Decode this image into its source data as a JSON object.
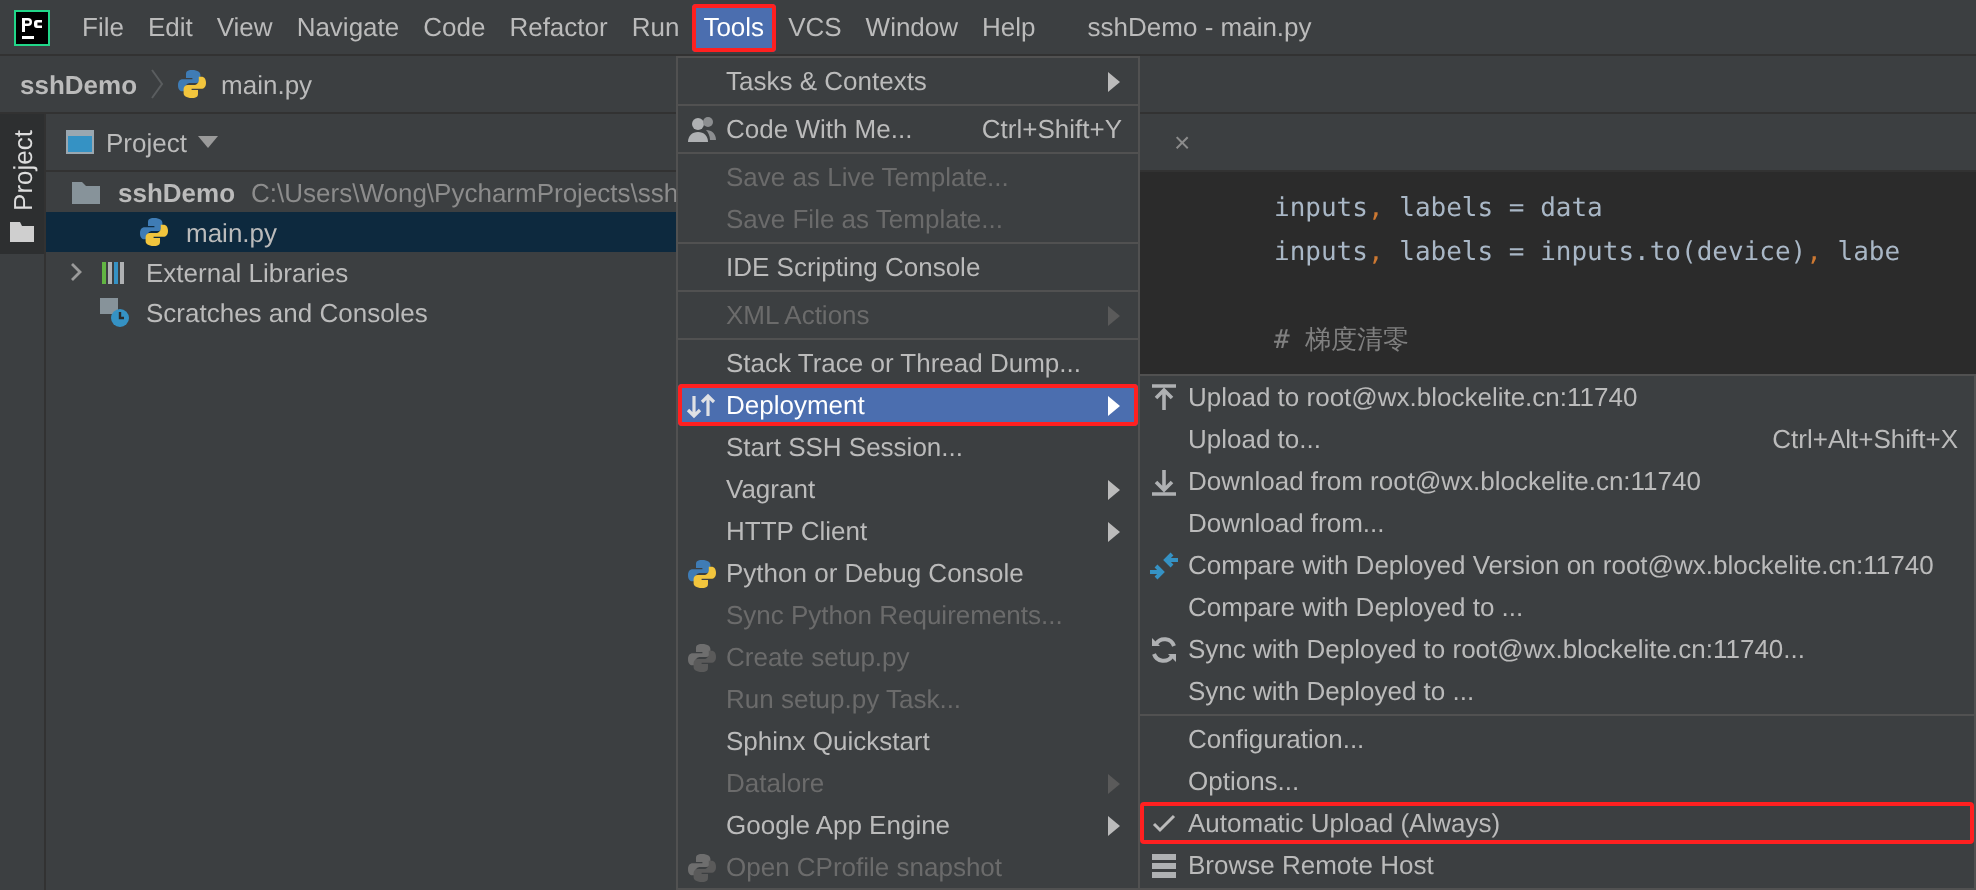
{
  "menubar": {
    "items": [
      {
        "label": "File",
        "selected": false,
        "annotated": false
      },
      {
        "label": "Edit",
        "selected": false,
        "annotated": false
      },
      {
        "label": "View",
        "selected": false,
        "annotated": false
      },
      {
        "label": "Navigate",
        "selected": false,
        "annotated": false
      },
      {
        "label": "Code",
        "selected": false,
        "annotated": false
      },
      {
        "label": "Refactor",
        "selected": false,
        "annotated": false
      },
      {
        "label": "Run",
        "selected": false,
        "annotated": false
      },
      {
        "label": "Tools",
        "selected": true,
        "annotated": true
      },
      {
        "label": "VCS",
        "selected": false,
        "annotated": false
      },
      {
        "label": "Window",
        "selected": false,
        "annotated": false
      },
      {
        "label": "Help",
        "selected": false,
        "annotated": false
      }
    ],
    "title": "sshDemo - main.py"
  },
  "breadcrumb": [
    {
      "label": "sshDemo",
      "kind": "project"
    },
    {
      "label": "main.py",
      "kind": "python"
    }
  ],
  "tool_strip": {
    "label": "Project"
  },
  "project_panel": {
    "title": "Project",
    "tree": [
      {
        "label": "sshDemo",
        "kind": "project",
        "path": "C:\\Users\\Wong\\PycharmProjects\\ssh",
        "expanded": true,
        "selected": false,
        "children": [
          {
            "label": "main.py",
            "kind": "python",
            "selected": true
          }
        ]
      },
      {
        "label": "External Libraries",
        "kind": "libraries",
        "expanded": false,
        "selected": false
      },
      {
        "label": "Scratches and Consoles",
        "kind": "scratches",
        "selected": false
      }
    ]
  },
  "editor": {
    "tab_close": "×",
    "lines": [
      {
        "blank_above": false,
        "tokens": [
          {
            "text": "inputs",
            "kind": "name"
          },
          {
            "text": ", ",
            "kind": "punct"
          },
          {
            "text": "labels = data",
            "kind": "name"
          }
        ]
      },
      {
        "blank_above": false,
        "tokens": [
          {
            "text": "inputs",
            "kind": "name"
          },
          {
            "text": ", ",
            "kind": "punct"
          },
          {
            "text": "labels = inputs.to(device)",
            "kind": "name"
          },
          {
            "text": ", ",
            "kind": "punct"
          },
          {
            "text": "labe",
            "kind": "name"
          }
        ]
      },
      {
        "blank_above": true,
        "tokens": [
          {
            "text": "# 梯度清零",
            "kind": "comment"
          }
        ]
      }
    ]
  },
  "tools_menu": {
    "items": [
      {
        "kind": "item",
        "label": "Tasks & Contexts",
        "submenu": true,
        "disabled": false,
        "selected": false,
        "annotated": false
      },
      {
        "kind": "separator"
      },
      {
        "kind": "item",
        "label": "Code With Me...",
        "shortcut": "Ctrl+Shift+Y",
        "submenu": false,
        "disabled": false,
        "selected": false,
        "annotated": false
      },
      {
        "kind": "separator"
      },
      {
        "kind": "item",
        "label": "Save as Live Template...",
        "submenu": false,
        "disabled": true,
        "selected": false,
        "annotated": false
      },
      {
        "kind": "item",
        "label": "Save File as Template...",
        "submenu": false,
        "disabled": true,
        "selected": false,
        "annotated": false
      },
      {
        "kind": "separator"
      },
      {
        "kind": "item",
        "label": "IDE Scripting Console",
        "submenu": false,
        "disabled": false,
        "selected": false,
        "annotated": false
      },
      {
        "kind": "separator"
      },
      {
        "kind": "item",
        "label": "XML Actions",
        "submenu": true,
        "disabled": true,
        "selected": false,
        "annotated": false
      },
      {
        "kind": "separator"
      },
      {
        "kind": "item",
        "label": "Stack Trace or Thread Dump...",
        "submenu": false,
        "disabled": false,
        "selected": false,
        "annotated": false
      },
      {
        "kind": "item",
        "label": "Deployment",
        "submenu": true,
        "disabled": false,
        "selected": true,
        "annotated": true
      },
      {
        "kind": "item",
        "label": "Start SSH Session...",
        "submenu": false,
        "disabled": false,
        "selected": false,
        "annotated": false
      },
      {
        "kind": "item",
        "label": "Vagrant",
        "submenu": true,
        "disabled": false,
        "selected": false,
        "annotated": false
      },
      {
        "kind": "item",
        "label": "HTTP Client",
        "submenu": true,
        "disabled": false,
        "selected": false,
        "annotated": false
      },
      {
        "kind": "item",
        "label": "Python or Debug Console",
        "submenu": false,
        "disabled": false,
        "selected": false,
        "annotated": false
      },
      {
        "kind": "item",
        "label": "Sync Python Requirements...",
        "submenu": false,
        "disabled": true,
        "selected": false,
        "annotated": false
      },
      {
        "kind": "item",
        "label": "Create setup.py",
        "submenu": false,
        "disabled": true,
        "selected": false,
        "annotated": false
      },
      {
        "kind": "item",
        "label": "Run setup.py Task...",
        "submenu": false,
        "disabled": true,
        "selected": false,
        "annotated": false
      },
      {
        "kind": "item",
        "label": "Sphinx Quickstart",
        "submenu": false,
        "disabled": false,
        "selected": false,
        "annotated": false
      },
      {
        "kind": "item",
        "label": "Datalore",
        "submenu": true,
        "disabled": true,
        "selected": false,
        "annotated": false
      },
      {
        "kind": "item",
        "label": "Google App Engine",
        "submenu": true,
        "disabled": false,
        "selected": false,
        "annotated": false
      },
      {
        "kind": "item",
        "label": "Open CProfile snapshot",
        "submenu": false,
        "disabled": true,
        "selected": false,
        "annotated": false
      }
    ]
  },
  "deployment_submenu": {
    "items": [
      {
        "kind": "item",
        "label": "Upload to root@wx.blockelite.cn:11740",
        "checked": false,
        "annotated": false
      },
      {
        "kind": "item",
        "label": "Upload to...",
        "shortcut": "Ctrl+Alt+Shift+X",
        "checked": false,
        "annotated": false
      },
      {
        "kind": "item",
        "label": "Download from root@wx.blockelite.cn:11740",
        "checked": false,
        "annotated": false
      },
      {
        "kind": "item",
        "label": "Download from...",
        "checked": false,
        "annotated": false
      },
      {
        "kind": "item",
        "label": "Compare with Deployed Version on root@wx.blockelite.cn:11740",
        "checked": false,
        "annotated": false
      },
      {
        "kind": "item",
        "label": "Compare with Deployed to ...",
        "checked": false,
        "annotated": false
      },
      {
        "kind": "item",
        "label": "Sync with Deployed to root@wx.blockelite.cn:11740...",
        "checked": false,
        "annotated": false
      },
      {
        "kind": "item",
        "label": "Sync with Deployed to ...",
        "checked": false,
        "annotated": false
      },
      {
        "kind": "separator"
      },
      {
        "kind": "item",
        "label": "Configuration...",
        "checked": false,
        "annotated": false
      },
      {
        "kind": "item",
        "label": "Options...",
        "checked": false,
        "annotated": false
      },
      {
        "kind": "item",
        "label": "Automatic Upload (Always)",
        "checked": true,
        "annotated": true
      },
      {
        "kind": "item",
        "label": "Browse Remote Host",
        "checked": false,
        "annotated": false
      }
    ]
  }
}
